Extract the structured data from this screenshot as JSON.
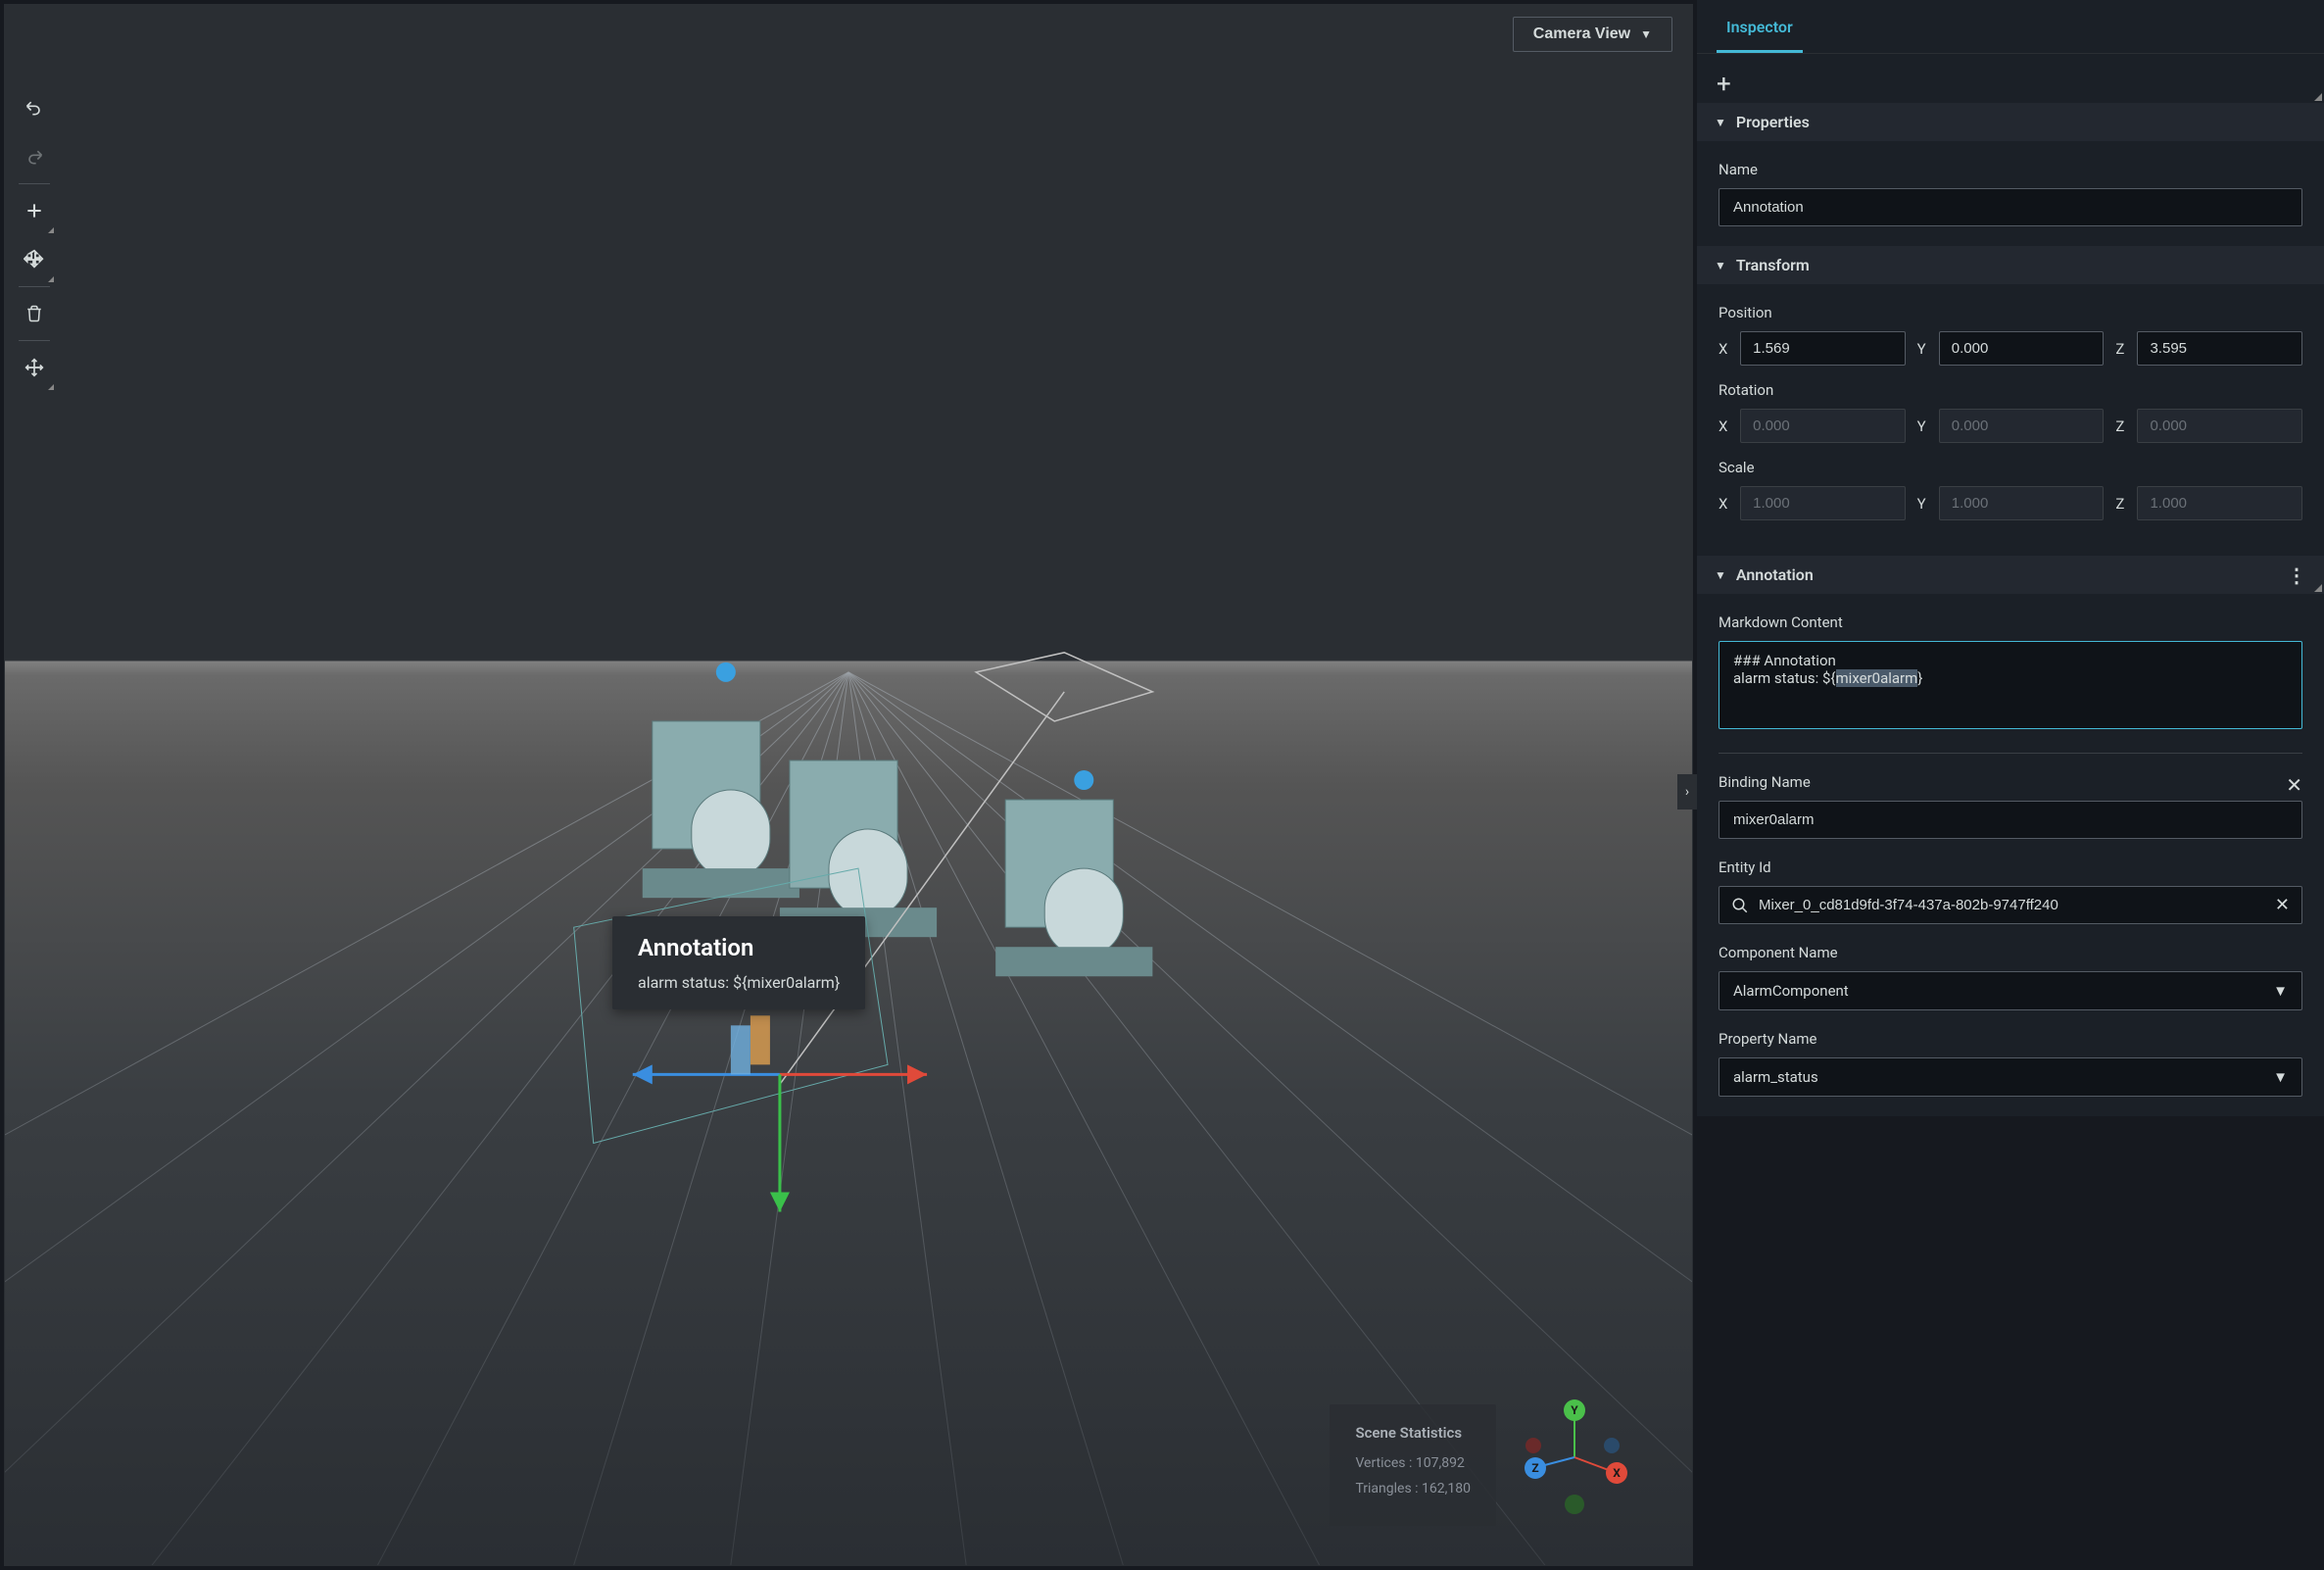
{
  "camera_view": {
    "label": "Camera View"
  },
  "annotation_overlay": {
    "title": "Annotation",
    "status_line": "alarm status: ${mixer0alarm}"
  },
  "scene_stats": {
    "title": "Scene Statistics",
    "vertices_label": "Vertices : ",
    "vertices_value": "107,892",
    "triangles_label": "Triangles : ",
    "triangles_value": "162,180"
  },
  "inspector": {
    "tab_label": "Inspector",
    "properties": {
      "header": "Properties",
      "name_label": "Name",
      "name_value": "Annotation"
    },
    "transform": {
      "header": "Transform",
      "position_label": "Position",
      "position": {
        "x": "1.569",
        "y": "0.000",
        "z": "3.595"
      },
      "rotation_label": "Rotation",
      "rotation": {
        "x": "0.000",
        "y": "0.000",
        "z": "0.000"
      },
      "scale_label": "Scale",
      "scale": {
        "x": "1.000",
        "y": "1.000",
        "z": "1.000"
      }
    },
    "annotation": {
      "header": "Annotation",
      "markdown_label": "Markdown Content",
      "markdown_line1": "### Annotation",
      "markdown_line2_prefix": "alarm status: ${",
      "markdown_line2_highlight": "mixer0alarm",
      "markdown_line2_suffix": "}",
      "binding_name_label": "Binding Name",
      "binding_name_value": "mixer0alarm",
      "entity_id_label": "Entity Id",
      "entity_id_value": "Mixer_0_cd81d9fd-3f74-437a-802b-9747ff240",
      "component_name_label": "Component Name",
      "component_name_value": "AlarmComponent",
      "property_name_label": "Property Name",
      "property_name_value": "alarm_status"
    }
  },
  "axis_labels": {
    "x": "X",
    "y": "Y",
    "z": "Z"
  }
}
